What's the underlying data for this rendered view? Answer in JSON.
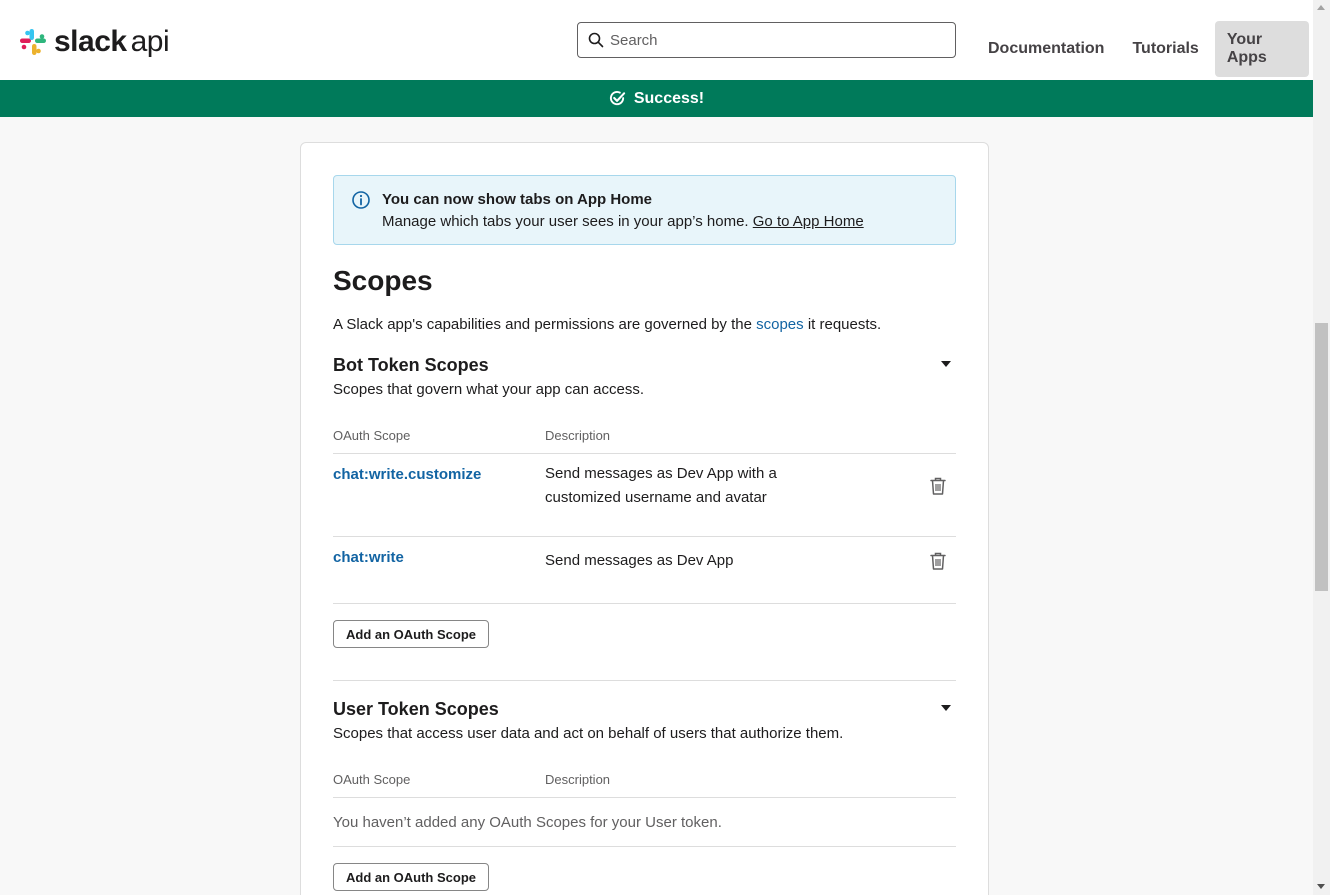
{
  "nav": {
    "logo_word": "slack",
    "logo_suffix": "api",
    "search_placeholder": "Search",
    "links": [
      {
        "label": "Documentation",
        "active": false
      },
      {
        "label": "Tutorials",
        "active": false
      },
      {
        "label": "Your Apps",
        "active": true
      }
    ]
  },
  "banner": {
    "text": "Success!",
    "color": "#007a5a"
  },
  "info": {
    "title": "You can now show tabs on App Home",
    "text": "Manage which tabs your user sees in your app’s home.",
    "link": "Go to App Home",
    "icon": "info-circle-icon"
  },
  "page": {
    "title": "Scopes",
    "intro_before": "A Slack app's capabilities and permissions are governed by the",
    "intro_link": "scopes",
    "intro_after": "it requests."
  },
  "bot": {
    "title": "Bot Token Scopes",
    "subtitle": "Scopes that govern what your app can access.",
    "col_scope": "OAuth Scope",
    "col_desc": "Description",
    "rows": [
      {
        "scope": "chat:write.customize",
        "desc_line1": "Send messages as Dev App with a",
        "desc_line2": "customized username and avatar"
      },
      {
        "scope": "chat:write",
        "desc_line1": "Send messages as Dev App",
        "desc_line2": ""
      }
    ],
    "add_button": "Add an OAuth Scope"
  },
  "user": {
    "title": "User Token Scopes",
    "subtitle": "Scopes that access user data and act on behalf of users that authorize them.",
    "col_scope": "OAuth Scope",
    "col_desc": "Description",
    "empty": "You haven’t added any OAuth Scopes for your User token.",
    "add_button": "Add an OAuth Scope"
  },
  "colors": {
    "link": "#1264a3",
    "brand_green": "#007a5a"
  }
}
